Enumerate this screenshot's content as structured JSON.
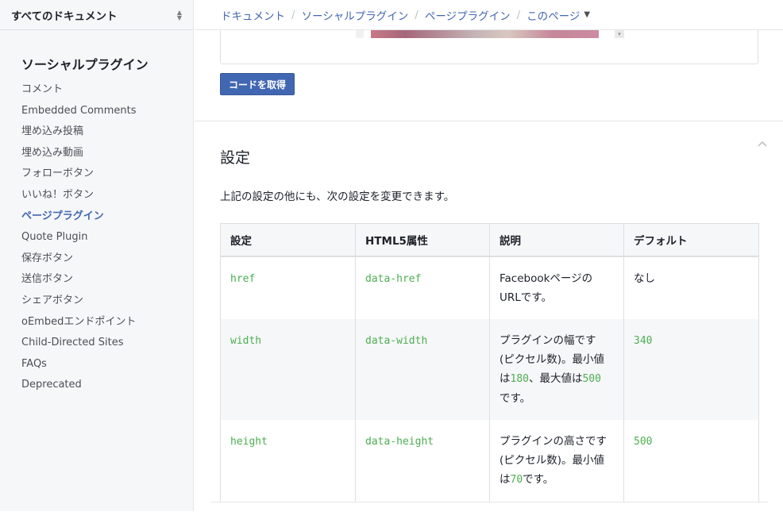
{
  "sidebar": {
    "doc_select_label": "すべてのドキュメント",
    "heading": "ソーシャルプラグイン",
    "items": [
      {
        "label": "コメント",
        "active": false
      },
      {
        "label": "Embedded Comments",
        "active": false
      },
      {
        "label": "埋め込み投稿",
        "active": false
      },
      {
        "label": "埋め込み動画",
        "active": false
      },
      {
        "label": "フォローボタン",
        "active": false
      },
      {
        "label": "いいね！ボタン",
        "active": false
      },
      {
        "label": "ページプラグイン",
        "active": true
      },
      {
        "label": "Quote Plugin",
        "active": false
      },
      {
        "label": "保存ボタン",
        "active": false
      },
      {
        "label": "送信ボタン",
        "active": false
      },
      {
        "label": "シェアボタン",
        "active": false
      },
      {
        "label": "oEmbedエンドポイント",
        "active": false
      },
      {
        "label": "Child-Directed Sites",
        "active": false
      },
      {
        "label": "FAQs",
        "active": false
      },
      {
        "label": "Deprecated",
        "active": false
      }
    ]
  },
  "breadcrumb": {
    "items": [
      "ドキュメント",
      "ソーシャルプラグイン",
      "ページプラグイン",
      "このページ"
    ]
  },
  "main": {
    "get_code_label": "コードを取得",
    "section_title": "設定",
    "section_desc": "上記の設定の他にも、次の設定を変更できます。",
    "table": {
      "headers": [
        "設定",
        "HTML5属性",
        "説明",
        "デフォルト"
      ],
      "rows": [
        {
          "setting": "href",
          "attr": "data-href",
          "desc_parts": [
            "Facebookページの",
            "URLです。"
          ],
          "default": "なし",
          "default_code": false
        },
        {
          "setting": "width",
          "attr": "data-width",
          "desc_a": "プラグインの幅です",
          "desc_b": "(ピクセル数)。最小値",
          "desc_c1": "は",
          "desc_c_code1": "180",
          "desc_c2": "、最大値は",
          "desc_c_code2": "500",
          "desc_d": "です。",
          "default": "340",
          "default_code": true
        },
        {
          "setting": "height",
          "attr": "data-height",
          "desc_a": "プラグインの高さです",
          "desc_b": "(ピクセル数)。最小値",
          "desc_c1": "は",
          "desc_c_code1": "70",
          "desc_c2": "です。",
          "default": "500",
          "default_code": true
        }
      ]
    }
  },
  "colors": {
    "accent": "#4267b2",
    "code": "#4caf50",
    "sidebar_bg": "#f6f7f9"
  }
}
